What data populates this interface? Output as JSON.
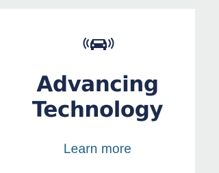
{
  "card": {
    "icon": "car-signal-icon",
    "title_line1": "Advancing",
    "title_line2": "Technology",
    "link_label": "Learn more",
    "colors": {
      "title": "#1c2a4c",
      "link": "#1f5f86",
      "icon": "#1c2a4c",
      "background": "#ffffff",
      "page": "#eceeee"
    }
  }
}
